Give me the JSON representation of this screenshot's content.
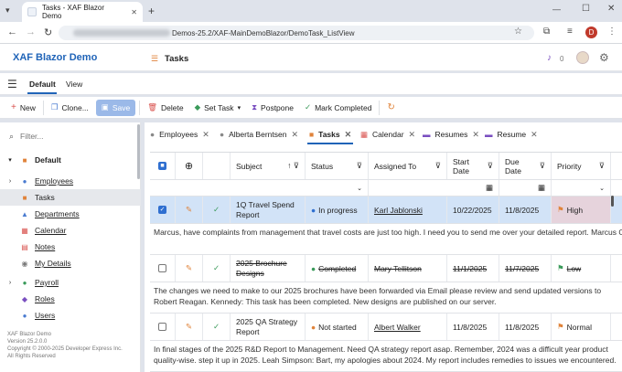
{
  "browser": {
    "tab_title": "Tasks - XAF Blazor Demo",
    "url": "Demos-25.2/XAF-MainDemoBlazor/DemoTask_ListView",
    "profile_initial": "D"
  },
  "app": {
    "brand": "XAF Blazor Demo",
    "page_title": "Tasks",
    "notif_count": "0"
  },
  "view_tabs": [
    "Default",
    "View"
  ],
  "toolbar": {
    "new": "New",
    "clone": "Clone...",
    "save": "Save",
    "delete": "Delete",
    "set_task": "Set Task",
    "postpone": "Postpone",
    "mark_completed": "Mark Completed"
  },
  "sidebar": {
    "filter_placeholder": "Filter...",
    "group": "Default",
    "items": [
      {
        "label": "Employees",
        "color": "#4a7bd0"
      },
      {
        "label": "Tasks",
        "color": "#e0833a"
      },
      {
        "label": "Departments",
        "color": "#4a7bd0"
      },
      {
        "label": "Calendar",
        "color": "#d9534f"
      },
      {
        "label": "Notes",
        "color": "#d9534f"
      },
      {
        "label": "My Details",
        "color": "#7a7a7a"
      },
      {
        "label": "Payroll",
        "color": "#3a9a5a"
      },
      {
        "label": "Roles",
        "color": "#7a4fc0"
      },
      {
        "label": "Users",
        "color": "#4a7bd0"
      }
    ],
    "footer": [
      "XAF Blazor Demo",
      "Version 25.2.0.0",
      "Copyright © 2000-2025 Developer Express Inc.",
      "All Rights Reserved"
    ]
  },
  "doc_tabs": [
    {
      "label": "Employees",
      "icon": "person-icon",
      "color": "#888"
    },
    {
      "label": "Alberta Berntsen",
      "icon": "person-icon",
      "color": "#888"
    },
    {
      "label": "Tasks",
      "icon": "task-icon",
      "color": "#e0833a"
    },
    {
      "label": "Calendar",
      "icon": "calendar-icon",
      "color": "#d9534f"
    },
    {
      "label": "Resumes",
      "icon": "resume-icon",
      "color": "#7a4fc0"
    },
    {
      "label": "Resume",
      "icon": "resume-icon",
      "color": "#7a4fc0"
    }
  ],
  "grid": {
    "columns": [
      "Subject",
      "Status",
      "Assigned To",
      "Start Date",
      "Due Date",
      "Priority"
    ],
    "rows": [
      {
        "subject": "1Q Travel Spend Report",
        "status": "In progress",
        "status_color": "#2f6fd0",
        "assigned": "Karl Jablonski",
        "start": "10/22/2025",
        "due": "11/8/2025",
        "priority": "High",
        "priority_color": "#e0833a",
        "selected": true,
        "done": false,
        "preview": "Marcus, have complaints from management that travel costs are just too high. I need you to send me over your detailed report. Marcus Orbison: take me a while to compile it."
      },
      {
        "subject": "2025 Brochure Designs",
        "status": "Completed",
        "status_color": "#3a9a5a",
        "assigned": "Mary Tellitson",
        "start": "11/1/2025",
        "due": "11/7/2025",
        "priority": "Low",
        "priority_color": "#3a9a5a",
        "selected": false,
        "done": true,
        "preview": "The changes we need to make to our 2025 brochures have been forwarded via Email please review and send updated versions to Robert Reagan. Kennedy: This task has been completed. New designs are published on our server."
      },
      {
        "subject": "2025 QA Strategy Report",
        "status": "Not started",
        "status_color": "#e0833a",
        "assigned": "Albert Walker",
        "start": "11/8/2025",
        "due": "11/8/2025",
        "priority": "Normal",
        "priority_color": "#e0833a",
        "selected": false,
        "done": false,
        "preview": "In final stages of the 2025 R&D Report to Management. Need QA strategy report asap. Remember, 2024 was a difficult year product quality-wise. step it up in 2025. Leah Simpson: Bart, my apologies about 2024. My report includes remedies to issues we encountered."
      }
    ]
  }
}
